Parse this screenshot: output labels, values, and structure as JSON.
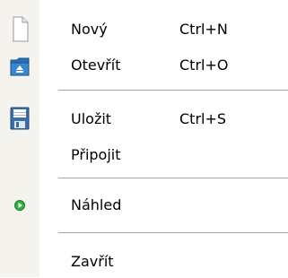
{
  "menu": {
    "items": [
      {
        "label": "Nový",
        "shortcut": "Ctrl+N",
        "icon": "new-document-icon"
      },
      {
        "label": "Otevřít",
        "shortcut": "Ctrl+O",
        "icon": "open-folder-icon"
      },
      {
        "label": "Uložit",
        "shortcut": "Ctrl+S",
        "icon": "save-floppy-icon"
      },
      {
        "label": "Připojit",
        "shortcut": "",
        "icon": ""
      },
      {
        "label": "Náhled",
        "shortcut": "",
        "icon": "preview-play-icon"
      },
      {
        "label": "Zavřít",
        "shortcut": "",
        "icon": ""
      }
    ],
    "colors": {
      "gutter": "#f4f3ee",
      "separator": "#a7a6aa",
      "folder_blue": "#2b6fb5",
      "floppy_blue": "#3a6ea5",
      "play_green": "#2fb13a"
    }
  }
}
